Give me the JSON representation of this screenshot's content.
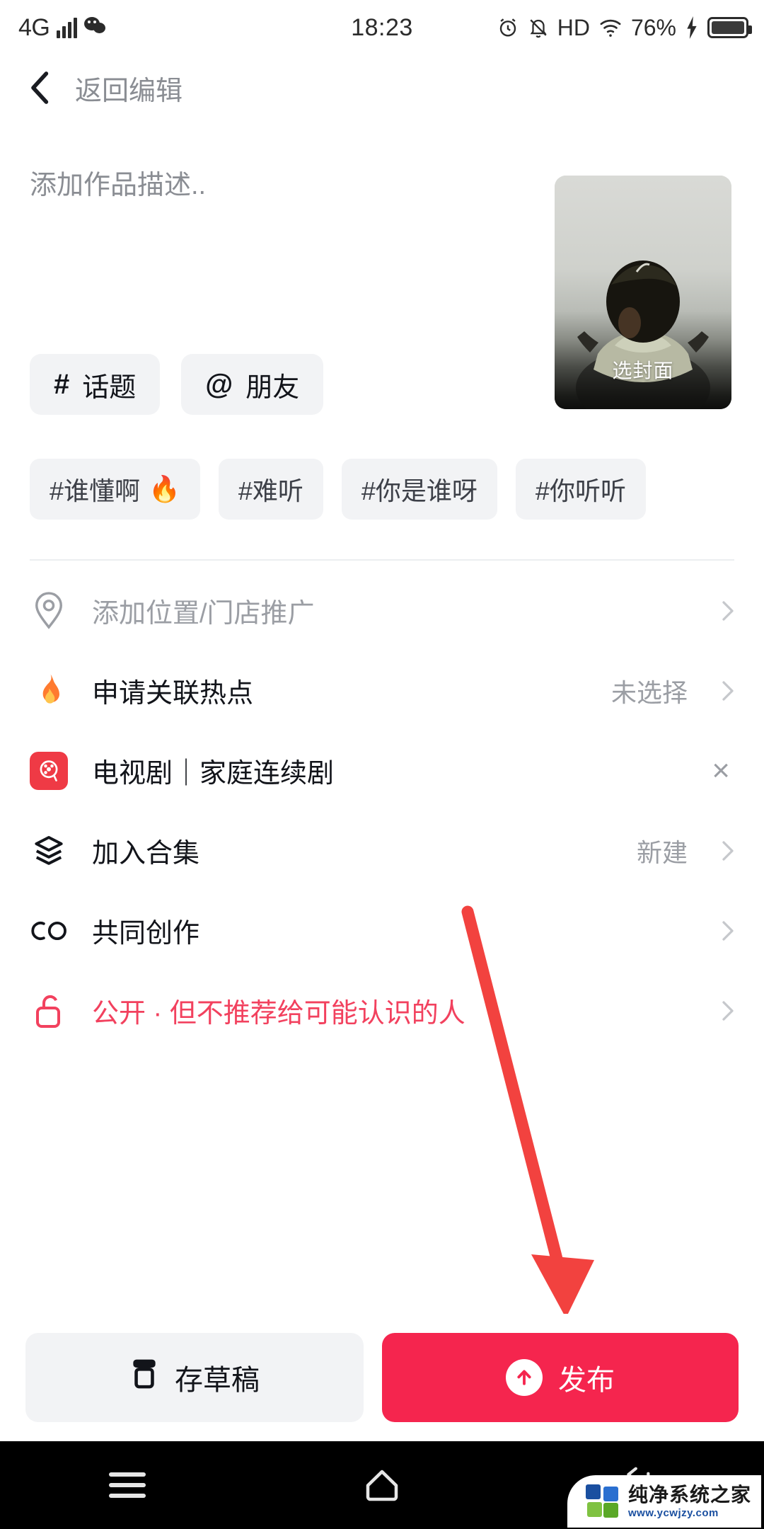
{
  "status_bar": {
    "network": "4G",
    "signal_icon": "signal-bars-icon",
    "app_icon": "wechat-icon",
    "time": "18:23",
    "alarm_icon": "alarm-clock-icon",
    "mute_icon": "bell-muted-icon",
    "hd": "HD",
    "wifi_icon": "wifi-icon",
    "battery_percent": "76%",
    "charging_icon": "lightning-bolt-icon"
  },
  "header": {
    "back_icon": "back-chevron-icon",
    "title": "返回编辑"
  },
  "description": {
    "placeholder": "添加作品描述..",
    "value": ""
  },
  "cover": {
    "label": "选封面",
    "image_alt": "child with outstretched arms"
  },
  "chips": [
    {
      "symbol": "#",
      "label": "话题",
      "name": "topic-chip"
    },
    {
      "symbol": "@",
      "label": "朋友",
      "name": "friend-chip"
    }
  ],
  "hashtag_suggestions": [
    {
      "label": "#谁懂啊",
      "emoji": "🔥"
    },
    {
      "label": "#难听",
      "emoji": ""
    },
    {
      "label": "#你是谁呀",
      "emoji": ""
    },
    {
      "label": "#你听听",
      "emoji": ""
    }
  ],
  "rows": [
    {
      "icon": "location-pin-icon",
      "label": "添加位置/门店推广",
      "value": "",
      "muted": true,
      "chevron": true
    },
    {
      "icon": "fire-icon",
      "label": "申请关联热点",
      "value": "未选择",
      "muted": false,
      "chevron": true
    },
    {
      "icon": "tv-drama-app-icon",
      "label": "电视剧｜家庭连续剧",
      "value": "",
      "muted": false,
      "chevron": false,
      "close": "×"
    },
    {
      "icon": "layers-icon",
      "label": "加入合集",
      "value": "新建",
      "muted": false,
      "chevron": true
    },
    {
      "icon": "co-create-icon",
      "label": "共同创作",
      "value": "",
      "muted": false,
      "chevron": true
    },
    {
      "icon": "unlock-icon",
      "label": "公开 · 但不推荐给可能认识的人",
      "value": "",
      "accent": true,
      "chevron": true
    }
  ],
  "actions": {
    "draft_icon": "save-draft-icon",
    "draft_label": "存草稿",
    "publish_icon": "upload-arrow-icon",
    "publish_label": "发布"
  },
  "annotation": {
    "type": "arrow",
    "color": "#f2423f",
    "points_to": "publish-button"
  },
  "navbar": {
    "menu_icon": "menu-icon",
    "home_icon": "home-icon",
    "back_icon": "back-arrow-icon"
  },
  "watermark": {
    "title": "纯净系统之家",
    "url": "www.ycwjzy.com"
  },
  "colors": {
    "accent_red": "#f5254e",
    "privacy_red": "#f2415e",
    "chip_bg": "#f2f3f5",
    "muted_text": "#9b9ea4",
    "annotation_red": "#f2423f"
  }
}
